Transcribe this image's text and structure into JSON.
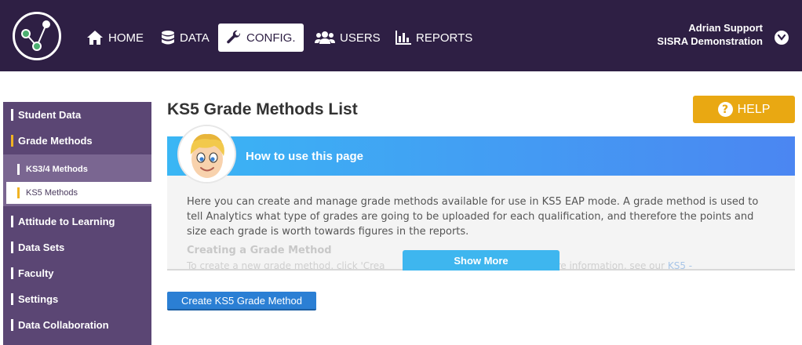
{
  "nav": {
    "items": [
      {
        "label": "HOME",
        "icon": "home-icon"
      },
      {
        "label": "DATA",
        "icon": "database-icon"
      },
      {
        "label": "CONFIG.",
        "icon": "wrench-icon",
        "active": true
      },
      {
        "label": "USERS",
        "icon": "users-icon"
      },
      {
        "label": "REPORTS",
        "icon": "bar-chart-icon"
      }
    ],
    "user_name": "Adrian Support",
    "user_org": "SISRA Demonstration"
  },
  "sidebar": {
    "items": [
      {
        "label": "Student Data"
      },
      {
        "label": "Grade Methods",
        "open": true
      },
      {
        "label": "Attitude to Learning"
      },
      {
        "label": "Data Sets"
      },
      {
        "label": "Faculty"
      },
      {
        "label": "Settings"
      },
      {
        "label": "Data Collaboration"
      }
    ],
    "subitems": [
      {
        "label": "KS3/4 Methods"
      },
      {
        "label": "KS5 Methods",
        "active": true
      }
    ]
  },
  "main": {
    "title": "KS5 Grade Methods List",
    "help_label": "HELP",
    "info": {
      "title": "How to use this page",
      "body": "Here you can create and manage grade methods available for use in KS5 EAP mode. A grade method is used to tell Analytics what type of grades are going to be uploaded for each qualification, and therefore the points and size each grade is worth towards figures in the reports.",
      "subheading": "Creating a Grade Method",
      "faded_prefix": "To create a new grade method, click 'Crea",
      "faded_middle": "more information, see our",
      "faded_link": "KS5 -",
      "show_more": "Show More"
    },
    "create_button": "Create KS5 Grade Method"
  },
  "colors": {
    "topbar": "#2e1f44",
    "sidebar": "#5b4674",
    "accent_yellow": "#e9a812",
    "info_gradient_start": "#3ab6f4",
    "info_gradient_end": "#4b86f2",
    "primary_button": "#2b7fd4"
  }
}
